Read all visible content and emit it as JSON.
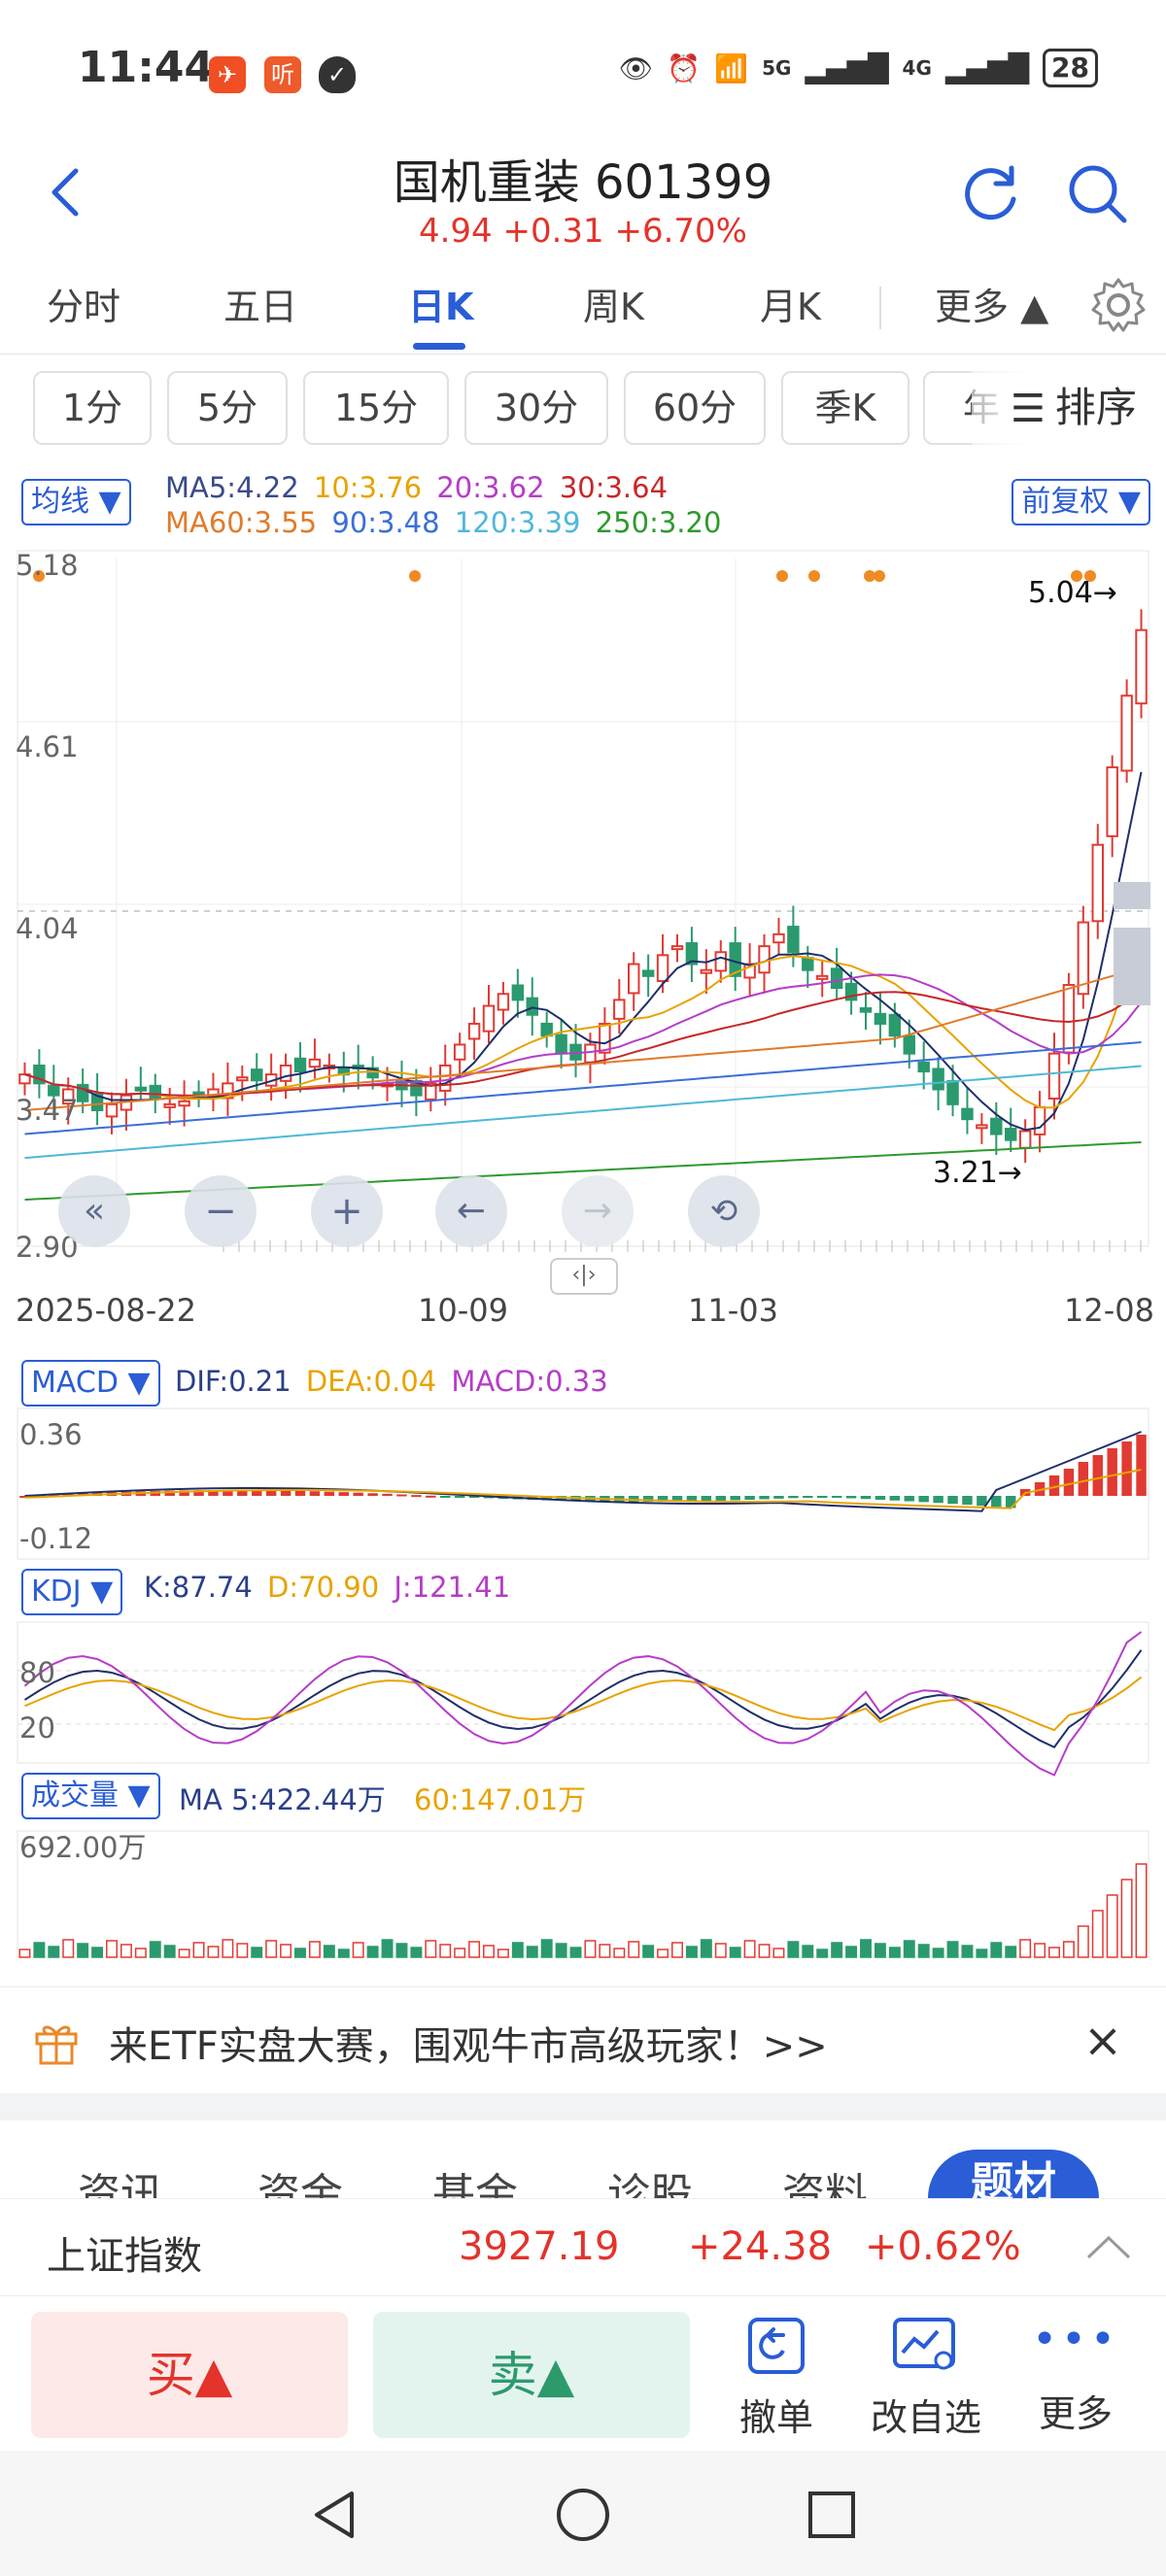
{
  "status_bar": {
    "time": "11:44",
    "battery": "28",
    "net1": "5G",
    "net2": "4G"
  },
  "header": {
    "title": "国机重装 601399",
    "quote": "4.94  +0.31  +6.70%"
  },
  "period_tabs": {
    "items": [
      "分时",
      "五日",
      "日K",
      "周K",
      "月K"
    ],
    "more": "更多 ▲",
    "active": "日K"
  },
  "minute_buttons": {
    "items": [
      "1分",
      "5分",
      "15分",
      "30分",
      "60分",
      "季K",
      "年"
    ],
    "sort": "排序"
  },
  "indicator": {
    "ma_pill": "均线 ▼",
    "adj_pill": "前复权 ▼",
    "ma_row1": [
      "MA5:4.22",
      "10:3.76",
      "20:3.62",
      "30:3.64"
    ],
    "ma_row2": [
      "MA60:3.55",
      "90:3.48",
      "120:3.39",
      "250:3.20"
    ],
    "colors": [
      "#222222",
      "#e8a300",
      "#b63cc8",
      "#c62828",
      "#e07b2a",
      "#3a6fd8",
      "#4fb8d8",
      "#2e9a2e"
    ]
  },
  "chart_data": {
    "type": "candlestick",
    "y_ticks": [
      "5.18",
      "4.61",
      "4.04",
      "3.47",
      "2.90"
    ],
    "x_labels": [
      "2025-08-22",
      "10-09",
      "11-03",
      "12-08"
    ],
    "high_label": "5.04→",
    "low_label": "3.21→",
    "candle_closes": [
      3.45,
      3.42,
      3.38,
      3.4,
      3.36,
      3.33,
      3.35,
      3.38,
      3.4,
      3.37,
      3.35,
      3.36,
      3.38,
      3.4,
      3.42,
      3.44,
      3.43,
      3.45,
      3.48,
      3.46,
      3.5,
      3.48,
      3.45,
      3.47,
      3.44,
      3.42,
      3.4,
      3.38,
      3.42,
      3.48,
      3.55,
      3.62,
      3.68,
      3.72,
      3.7,
      3.65,
      3.58,
      3.52,
      3.5,
      3.55,
      3.62,
      3.7,
      3.82,
      3.78,
      3.85,
      3.88,
      3.82,
      3.8,
      3.86,
      3.78,
      3.82,
      3.88,
      3.92,
      3.86,
      3.8,
      3.78,
      3.74,
      3.7,
      3.66,
      3.62,
      3.58,
      3.52,
      3.46,
      3.4,
      3.35,
      3.3,
      3.28,
      3.25,
      3.23,
      3.26,
      3.34,
      3.52,
      3.75,
      3.96,
      4.22,
      4.48,
      4.72,
      4.94
    ],
    "macd_pill": "MACD ▼",
    "macd_values": [
      "DIF:0.21",
      "DEA:0.04",
      "MACD:0.33"
    ],
    "macd_ticks": [
      "0.36",
      "-0.12"
    ],
    "kdj_pill": "KDJ ▼",
    "kdj_values": [
      "K:87.74",
      "D:70.90",
      "J:121.41"
    ],
    "kdj_ticks": [
      "80",
      "20"
    ],
    "vol_pill": "成交量 ▼",
    "vol_values": [
      "MA 5:422.44万",
      "60:147.01万"
    ],
    "vol_ticks": [
      "692.00万"
    ]
  },
  "promo": {
    "text": "来ETF实盘大赛，围观牛市高级玩家！>>"
  },
  "info_tabs": [
    "资讯",
    "资金",
    "基金",
    "诊股",
    "资料",
    "题材"
  ],
  "index_bar": {
    "name": "上证指数",
    "value": "3927.19",
    "change": "+24.38",
    "pct": "+0.62%"
  },
  "trade_bar": {
    "buy": "买▲",
    "sell": "卖▲",
    "tools": [
      "撤单",
      "改自选",
      "更多"
    ]
  }
}
